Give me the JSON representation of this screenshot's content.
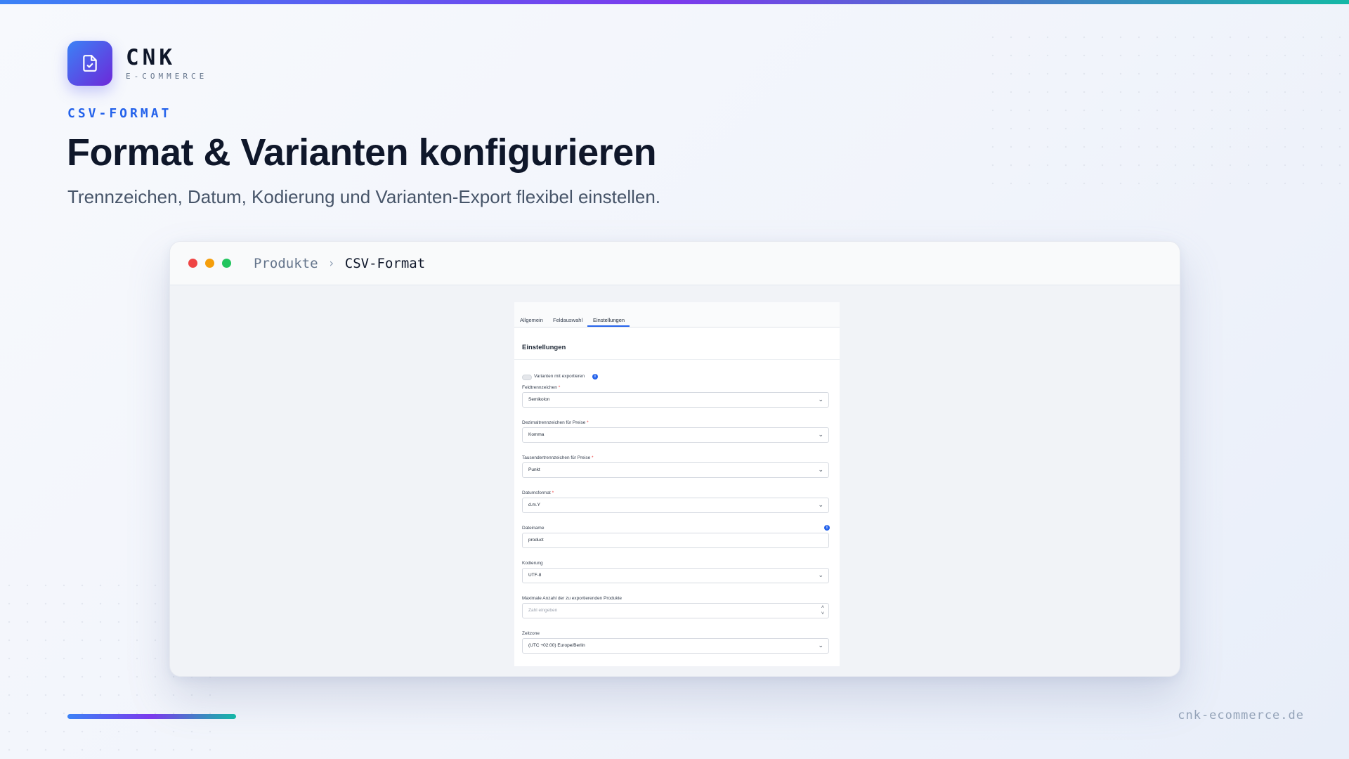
{
  "brand": {
    "name": "CNK",
    "tagline": "E-COMMERCE"
  },
  "eyebrow": "CSV-FORMAT",
  "headline": "Format & Varianten konfigurieren",
  "subline": "Trennzeichen, Datum, Kodierung und Varianten-Export flexibel einstellen.",
  "window": {
    "breadcrumb": [
      "Produkte",
      "CSV-Format"
    ],
    "separator": "›",
    "screenshot": {
      "tabs": [
        {
          "label": "Allgemein",
          "active": false
        },
        {
          "label": "Feldauswahl",
          "active": false
        },
        {
          "label": "Einstellungen",
          "active": true
        }
      ],
      "card_title": "Einstellungen",
      "toggle": {
        "label": "Varianten mit exportieren",
        "checked": false
      },
      "fields": [
        {
          "label": "Feldtrennzeichen",
          "required": true,
          "type": "select",
          "value": "Semikolon"
        },
        {
          "label": "Dezimaltrennzeichen für Preise",
          "required": true,
          "type": "select",
          "value": "Komma"
        },
        {
          "label": "Tausendertrennzeichen für Preise",
          "required": true,
          "type": "select",
          "value": "Punkt"
        },
        {
          "label": "Datumsformat",
          "required": true,
          "type": "select",
          "value": "d.m.Y"
        },
        {
          "label": "Dateiname",
          "required": false,
          "type": "text",
          "value": "product"
        },
        {
          "label": "Kodierung",
          "required": false,
          "type": "select",
          "value": "UTF-8"
        },
        {
          "label": "Maximale Anzahl der zu exportierenden Produkte",
          "required": false,
          "type": "number",
          "placeholder": "Zahl eingeben"
        },
        {
          "label": "Zeitzone",
          "required": false,
          "type": "select",
          "value": "(UTC +02:00) Europe/Berlin"
        }
      ],
      "required_mark": "*"
    }
  },
  "footer": {
    "url": "cnk-ecommerce.de"
  },
  "colors": {
    "accent": "#2563eb",
    "gradient_start": "#3b82f6",
    "gradient_mid": "#7c3aed",
    "gradient_end": "#14b8a6"
  }
}
